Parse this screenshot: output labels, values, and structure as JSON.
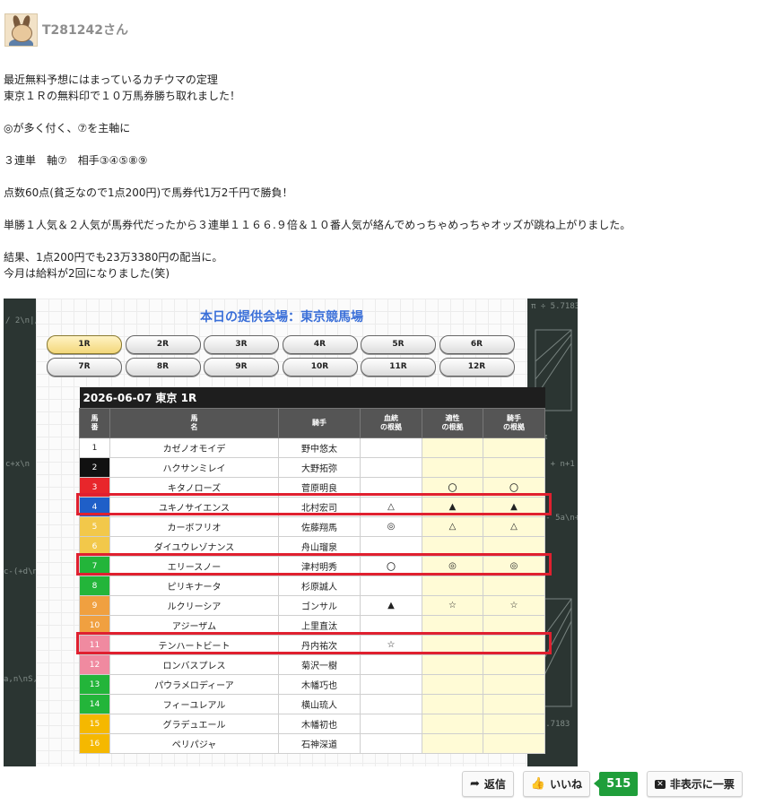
{
  "user": {
    "name": "T281242さん"
  },
  "post": {
    "lines": [
      "最近無料予想にはまっているカチウマの定理",
      "東京１Ｒの無料印で１０万馬券勝ち取れました！",
      "",
      "◎が多く付く、⑦を主軸に",
      "",
      "３連単　軸⑦　相手③④⑤⑧⑨",
      "",
      "点数60点(貧乏なので1点200円)で馬券代1万2千円で勝負！",
      "",
      "単勝１人気＆２人気が馬券代だったから３連単１１６６.９倍＆１０番人気が絡んでめっちゃめっちゃオッズが跳ね上がりました。",
      "",
      "結果、1点200円でも23万3380円の配当に。",
      "今月は給料が2回になりました(笑)"
    ]
  },
  "screenshot": {
    "venue_title": "本日の提供会場：東京競馬場",
    "races": [
      "1R",
      "2R",
      "3R",
      "4R",
      "5R",
      "6R",
      "7R",
      "8R",
      "9R",
      "10R",
      "11R",
      "12R"
    ],
    "selected_race": "1R",
    "table_caption": "2026-06-07 東京 1R",
    "headers": {
      "num": "馬\n番",
      "horse": "馬\n名",
      "jockey": "騎手",
      "blood": "血統\nの根拠",
      "aptitude": "適性\nの根拠",
      "jockey_basis": "騎手\nの根拠"
    },
    "horses": [
      {
        "num": "1",
        "name": "カゼノオモイデ",
        "jockey": "野中悠太",
        "blood": "",
        "apt": "",
        "jb": ""
      },
      {
        "num": "2",
        "name": "ハクサンミレイ",
        "jockey": "大野拓弥",
        "blood": "",
        "apt": "",
        "jb": ""
      },
      {
        "num": "3",
        "name": "キタノローズ",
        "jockey": "菅原明良",
        "blood": "",
        "apt": "〇",
        "jb": "〇"
      },
      {
        "num": "4",
        "name": "ユキノサイエンス",
        "jockey": "北村宏司",
        "blood": "△",
        "apt": "▲",
        "jb": "▲"
      },
      {
        "num": "5",
        "name": "カーボフリオ",
        "jockey": "佐藤翔馬",
        "blood": "◎",
        "apt": "△",
        "jb": "△"
      },
      {
        "num": "6",
        "name": "ダイユウレゾナンス",
        "jockey": "舟山瑠泉",
        "blood": "",
        "apt": "",
        "jb": ""
      },
      {
        "num": "7",
        "name": "エリースノー",
        "jockey": "津村明秀",
        "blood": "〇",
        "apt": "◎",
        "jb": "◎"
      },
      {
        "num": "8",
        "name": "ピリキナータ",
        "jockey": "杉原誠人",
        "blood": "",
        "apt": "",
        "jb": ""
      },
      {
        "num": "9",
        "name": "ルクリーシア",
        "jockey": "ゴンサル",
        "blood": "▲",
        "apt": "☆",
        "jb": "☆"
      },
      {
        "num": "10",
        "name": "アジーザム",
        "jockey": "上里直汰",
        "blood": "",
        "apt": "",
        "jb": ""
      },
      {
        "num": "11",
        "name": "テンハートビート",
        "jockey": "丹内祐次",
        "blood": "☆",
        "apt": "",
        "jb": ""
      },
      {
        "num": "12",
        "name": "ロンバスプレス",
        "jockey": "菊沢一樹",
        "blood": "",
        "apt": "",
        "jb": ""
      },
      {
        "num": "13",
        "name": "パウラメロディーア",
        "jockey": "木幡巧也",
        "blood": "",
        "apt": "",
        "jb": ""
      },
      {
        "num": "14",
        "name": "フィーユレアル",
        "jockey": "横山琉人",
        "blood": "",
        "apt": "",
        "jb": ""
      },
      {
        "num": "15",
        "name": "グラデュエール",
        "jockey": "木幡初也",
        "blood": "",
        "apt": "",
        "jb": ""
      },
      {
        "num": "16",
        "name": "ペリパジャ",
        "jockey": "石神深道",
        "blood": "",
        "apt": "",
        "jb": ""
      }
    ],
    "frame_colors": {
      "1": "#ffffff",
      "2": "#111111",
      "3": "#e8262b",
      "4": "#1f5fc8",
      "5": "#f2c84a",
      "6": "#f2c84a",
      "7": "#23b53a",
      "8": "#23b53a",
      "9": "#f0a040",
      "10": "#f0a040",
      "11": "#f08aa0",
      "12": "#f08aa0",
      "13": "#23b53a",
      "14": "#23b53a",
      "15": "#f5b800",
      "16": "#f5b800"
    },
    "highlight_rows": [
      "4",
      "7",
      "11"
    ]
  },
  "footer": {
    "reply_label": "返信",
    "like_label": "いいね",
    "like_count": "515",
    "hide_label": "非表示に一票",
    "icons": {
      "reply": "share-arrow-icon",
      "like": "thumbs-up-icon",
      "hide": "x-box-icon"
    }
  }
}
